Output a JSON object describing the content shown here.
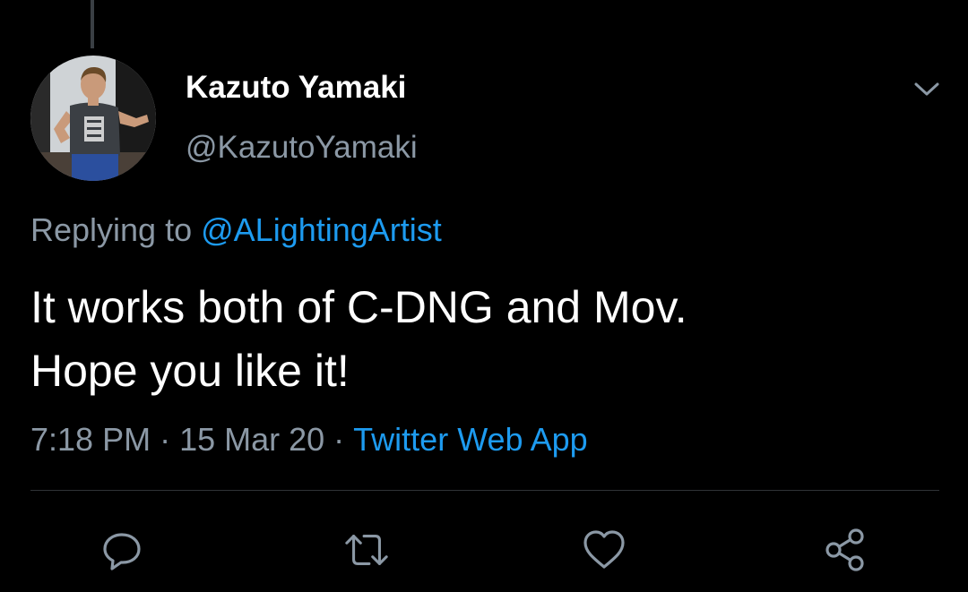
{
  "tweet": {
    "author": {
      "display_name": "Kazuto Yamaki",
      "handle": "@KazutoYamaki"
    },
    "reply": {
      "prefix": "Replying to",
      "mention": "@ALightingArtist"
    },
    "text_lines": [
      "It works both of C-DNG and Mov.",
      "Hope you like it!"
    ],
    "meta": {
      "time": "7:18 PM",
      "separator": "·",
      "date": "15 Mar 20",
      "source": "Twitter Web App"
    },
    "actions": [
      {
        "name": "reply",
        "icon": "reply-icon"
      },
      {
        "name": "retweet",
        "icon": "retweet-icon"
      },
      {
        "name": "like",
        "icon": "heart-icon"
      },
      {
        "name": "share",
        "icon": "share-icon"
      }
    ]
  },
  "colors": {
    "background": "#000000",
    "primary_text": "#ffffff",
    "secondary_text": "#8b98a5",
    "accent": "#1d9bf0",
    "divider": "#2f3336"
  }
}
